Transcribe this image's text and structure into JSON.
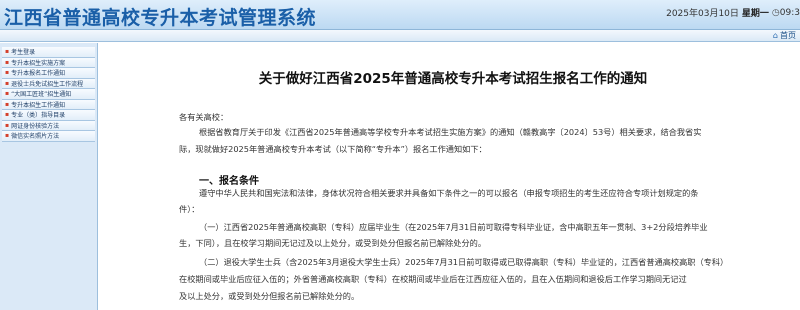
{
  "header": {
    "title": "江西省普通高校专升本考试管理系统",
    "date": "2025年03月10日",
    "weekday": "星期一",
    "time": "09:3",
    "clock_icon": "clock-icon"
  },
  "subbar": {
    "home_label": "首页",
    "home_icon": "house-icon"
  },
  "sidebar": {
    "items": [
      {
        "label": "考生登录"
      },
      {
        "label": "专升本招生实施方案"
      },
      {
        "label": "专升本报名工作通知"
      },
      {
        "label": "退役士兵免试招生工作流程"
      },
      {
        "label": "“大国工匠班”招生通知"
      },
      {
        "label": "专升本招生工作通知"
      },
      {
        "label": "专业（类）指导目录"
      },
      {
        "label": "网证身份核验方法"
      },
      {
        "label": "微信实名照片方法"
      }
    ]
  },
  "notice": {
    "title": "关于做好江西省2025年普通高校专升本考试招生报名工作的通知",
    "greeting": "各有关高校：",
    "para1_line1": "根据省教育厅关于印发《江西省2025年普通高等学校专升本考试招生实施方案》的通知（赣教高字〔2024〕53号）相关要求，结合我省实",
    "para1_line2": "际，现就做好2025年普通高校专升本考试（以下简称“专升本”）报名工作通知如下：",
    "section1_heading": "一、报名条件",
    "para2_line1": "遵守中华人民共和国宪法和法律，身体状况符合相关要求并具备如下条件之一的可以报名（申报专项招生的考生还应符合专项计划规定的条",
    "para2_line2": "件）：",
    "item1_line1": "（一）江西省2025年普通高校高职（专科）应届毕业生（在2025年7月31日前可取得专科毕业证，含中高职五年一贯制、3+2分段培养毕业",
    "item1_line2": "生，下同），且在校学习期间无记过及以上处分，或受到处分但报名前已解除处分的。",
    "item2_line1": "（二）退役大学生士兵（含2025年3月退役大学生士兵）2025年7月31日前可取得或已取得高职（专科）毕业证的，江西省普通高校高职（专科）",
    "item2_line2": "在校期间或毕业后应征入伍的；外省普通高校高职（专科）在校期间或毕业后在江西应征入伍的，且在入伍期间和退役后工作学习期间无记过",
    "item2_line3": "及以上处分，或受到处分但报名前已解除处分的。"
  }
}
